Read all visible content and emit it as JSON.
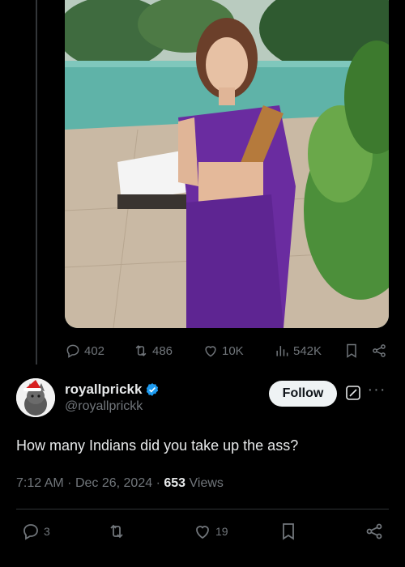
{
  "parent_post": {
    "stats": {
      "replies": "402",
      "reposts": "486",
      "likes": "10K",
      "views": "542K"
    }
  },
  "post": {
    "author": {
      "display_name": "royallprickk",
      "handle": "@royallprickk",
      "verified": true
    },
    "follow_label": "Follow",
    "text": "How many Indians did you take up the ass?",
    "time": "7:12 AM",
    "date": "Dec 26, 2024",
    "views_count": "653",
    "views_label": "Views",
    "stats": {
      "replies": "3",
      "likes": "19"
    }
  },
  "colors": {
    "background": "#000000",
    "text_primary": "#e7e9ea",
    "text_secondary": "#71767b",
    "verified_blue": "#1d9bf0",
    "divider": "#2f3336"
  },
  "icons": {
    "reply": "reply-icon",
    "repost": "repost-icon",
    "like": "like-icon",
    "views": "views-icon",
    "bookmark": "bookmark-icon",
    "share": "share-icon",
    "more": "more-icon",
    "grok": "grok-icon"
  }
}
